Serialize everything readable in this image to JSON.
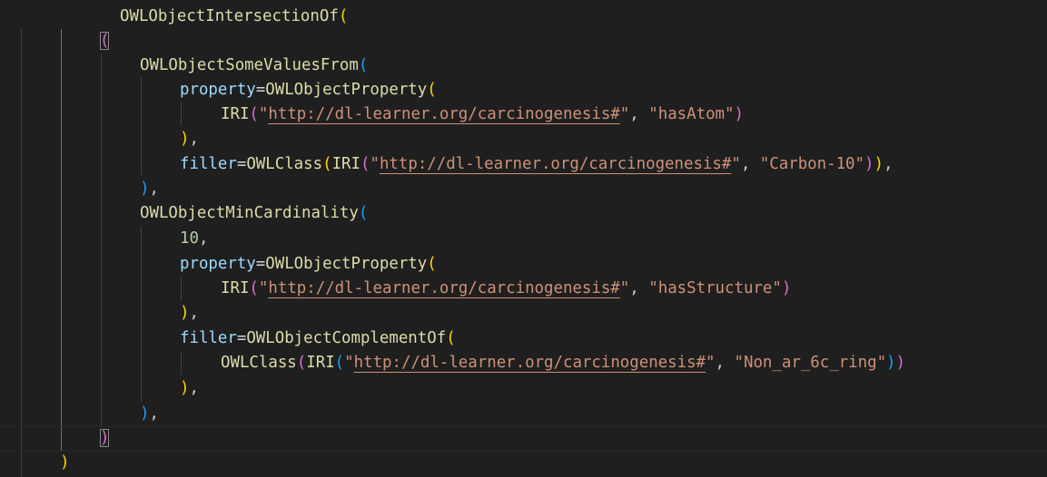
{
  "colors": {
    "background": "#1f1f1f",
    "function": "#dcdcaa",
    "parameter": "#9cdcfe",
    "string": "#ce9178",
    "number": "#b5cea8",
    "bracket_level_1": "#ffd700",
    "bracket_level_2": "#da70d6",
    "bracket_level_3": "#179fff"
  },
  "code": {
    "fn_intersection": "OWLObjectIntersectionOf",
    "fn_some_values": "OWLObjectSomeValuesFrom",
    "fn_object_property": "OWLObjectProperty",
    "fn_iri": "IRI",
    "fn_class": "OWLClass",
    "fn_min_cardinality": "OWLObjectMinCardinality",
    "fn_complement": "OWLObjectComplementOf",
    "param_property": "property",
    "param_filler": "filler",
    "iri_url": "http://dl-learner.org/carcinogenesis#",
    "name_has_atom": "hasAtom",
    "name_carbon": "Carbon-10",
    "name_has_structure": "hasStructure",
    "name_non_ar_ring": "Non_ar_6c_ring",
    "cardinality": "10"
  }
}
